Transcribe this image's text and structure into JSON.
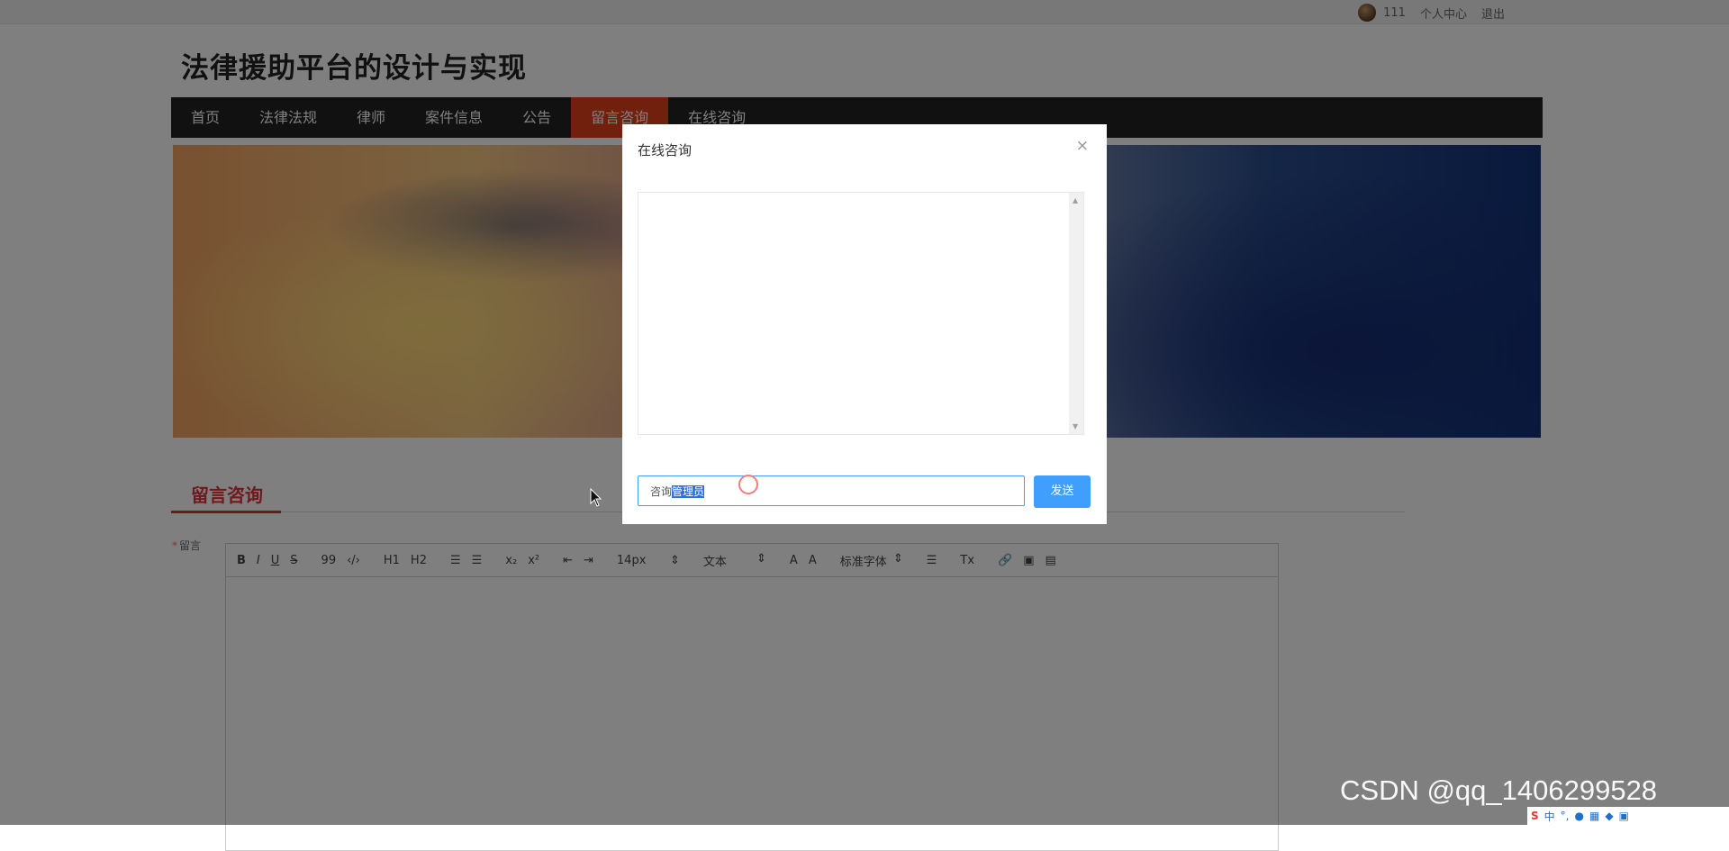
{
  "topbar": {
    "username": "111",
    "profile_link": "个人中心",
    "logout_link": "退出"
  },
  "site": {
    "title": "法律援助平台的设计与实现"
  },
  "nav": {
    "items": [
      "首页",
      "法律法规",
      "律师",
      "案件信息",
      "公告",
      "留言咨询",
      "在线咨询"
    ],
    "active_index": 5
  },
  "section": {
    "tab_label": "留言咨询"
  },
  "form": {
    "required_mark": "*",
    "field_label": "留言"
  },
  "editor": {
    "toolbar": {
      "bold": "B",
      "italic": "I",
      "underline": "U",
      "strike": "S",
      "quote": "99",
      "code": "‹/›",
      "h1": "H1",
      "h2": "H2",
      "ordered_list": "☰",
      "bullet_list": "☰",
      "subscript": "x₂",
      "superscript": "x²",
      "indent_left": "⇤",
      "indent_right": "⇥",
      "font_size": "14px",
      "block_type": "文本",
      "font_color": "A",
      "background_color": "A",
      "font_family": "标准字体",
      "align": "☰",
      "clear": "Tx",
      "link": "🔗",
      "image": "▣",
      "video": "▤"
    }
  },
  "dialog": {
    "title": "在线咨询",
    "close": "×",
    "input_prefix": "咨询",
    "input_selected": "管理员",
    "send": "发送"
  },
  "watermark": "CSDN @qq_1406299528",
  "tray": {
    "ime": "S",
    "lang": "中",
    "punct": "°,"
  }
}
